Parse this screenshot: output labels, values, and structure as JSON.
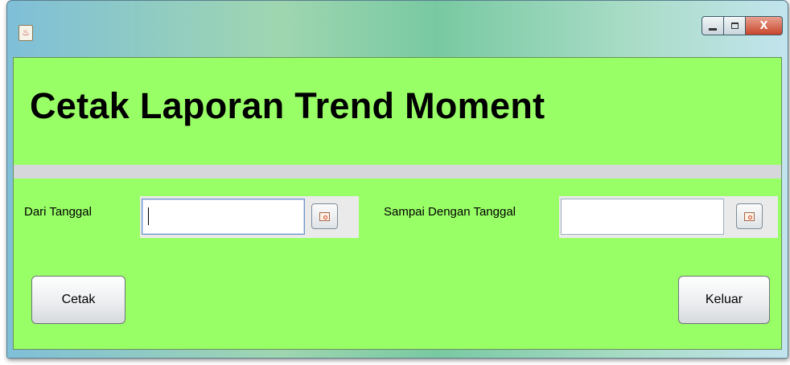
{
  "window": {
    "title": "",
    "controls": {
      "minimize": "",
      "maximize": "",
      "close": "X"
    }
  },
  "header": {
    "title": "Cetak Laporan Trend Moment"
  },
  "form": {
    "from_date": {
      "label": "Dari Tanggal",
      "value": ""
    },
    "to_date": {
      "label": "Sampai Dengan Tanggal",
      "value": ""
    }
  },
  "actions": {
    "print_label": "Cetak",
    "exit_label": "Keluar"
  },
  "colors": {
    "panel_background": "#99ff66",
    "separator": "#d5d7db"
  },
  "icons": {
    "app": "java-cup-icon",
    "date_picker": "calendar-icon"
  }
}
